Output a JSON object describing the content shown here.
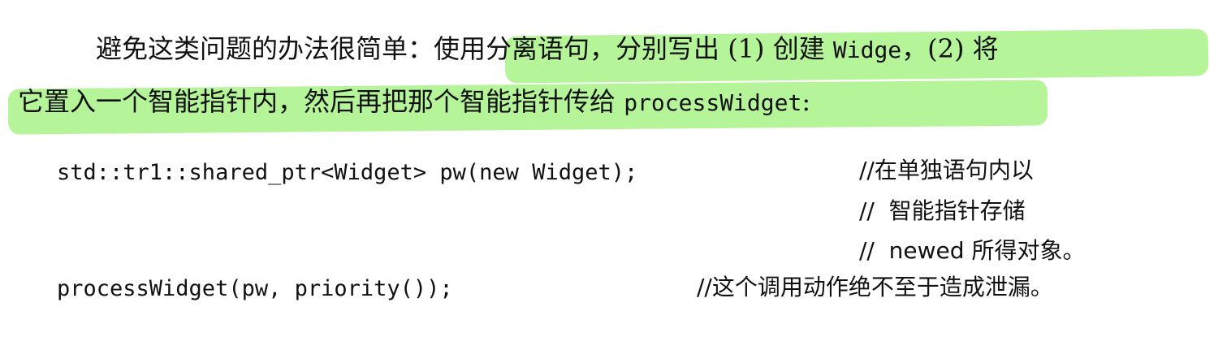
{
  "paragraph": {
    "line1_intro": "避免这类问题的办法很简单：",
    "line1_highlight": "使用分离语句，分别写出 (1) 创建 ",
    "line1_code": "Widge",
    "line1_tail": "，(2) 将",
    "line2_text": "它置入一个智能指针内，然后再把那个智能指针传给 ",
    "line2_code": "processWidget",
    "line2_tail": ":"
  },
  "code": {
    "statement1": "std::tr1::shared_ptr<Widget> pw(new Widget);",
    "comment1_line1": "//在单独语句内以",
    "comment1_line2": "//  智能指针存储",
    "comment1_line3": "//  newed 所得对象。",
    "statement2": "processWidget(pw, priority());",
    "comment2": "//这个调用动作绝不至于造成泄漏。"
  },
  "colors": {
    "highlight": "#78eb46",
    "text": "#111111"
  }
}
